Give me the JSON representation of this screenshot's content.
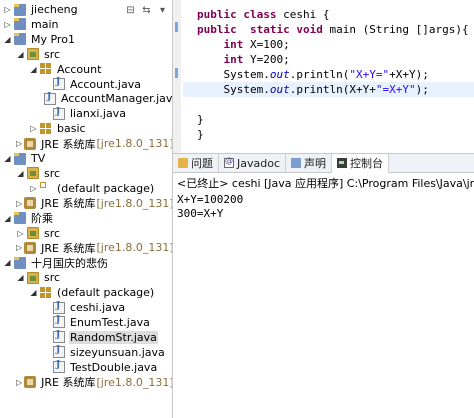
{
  "explorer": {
    "toolbar": {
      "collapse_icon": "collapse-all-icon",
      "link_icon": "link-editor-icon",
      "menu_icon": "view-menu-icon"
    },
    "tree": [
      {
        "label": "jiecheng",
        "icon": "project-icon",
        "depth": 0,
        "expanded": false
      },
      {
        "label": "main",
        "icon": "project-icon",
        "depth": 0,
        "expanded": false
      },
      {
        "label": "My Pro1",
        "icon": "project-icon",
        "depth": 0,
        "expanded": true
      },
      {
        "label": "src",
        "icon": "source-folder-icon",
        "depth": 1,
        "expanded": true
      },
      {
        "label": "Account",
        "icon": "package-icon",
        "depth": 2,
        "expanded": true
      },
      {
        "label": "Account.java",
        "icon": "java-file-icon",
        "depth": 3,
        "expanded": false
      },
      {
        "label": "AccountManager.java",
        "icon": "java-file-icon",
        "depth": 3,
        "expanded": false
      },
      {
        "label": "lianxi.java",
        "icon": "java-file-icon",
        "depth": 3,
        "expanded": false
      },
      {
        "label": "basic",
        "icon": "package-icon",
        "depth": 2,
        "expanded": false
      },
      {
        "label": "JRE 系统库",
        "sub": "[jre1.8.0_131]",
        "icon": "library-icon",
        "depth": 1,
        "expanded": false
      },
      {
        "label": "TV",
        "icon": "project-icon",
        "depth": 0,
        "expanded": true
      },
      {
        "label": "src",
        "icon": "source-folder-icon",
        "depth": 1,
        "expanded": true
      },
      {
        "label": "(default package)",
        "icon": "package-empty-icon",
        "depth": 2,
        "expanded": false
      },
      {
        "label": "JRE 系统库",
        "sub": "[jre1.8.0_131]",
        "icon": "library-icon",
        "depth": 1,
        "expanded": false
      },
      {
        "label": "阶乘",
        "icon": "project-icon",
        "depth": 0,
        "expanded": true
      },
      {
        "label": "src",
        "icon": "source-folder-icon",
        "depth": 1,
        "expanded": false
      },
      {
        "label": "JRE 系统库",
        "sub": "[jre1.8.0_131]",
        "icon": "library-icon",
        "depth": 1,
        "expanded": false
      },
      {
        "label": "十月国庆的悲伤",
        "icon": "project-icon",
        "depth": 0,
        "expanded": true
      },
      {
        "label": "src",
        "icon": "source-folder-icon",
        "depth": 1,
        "expanded": true
      },
      {
        "label": "(default package)",
        "icon": "package-icon",
        "depth": 2,
        "expanded": true
      },
      {
        "label": "ceshi.java",
        "icon": "java-file-icon",
        "depth": 3,
        "expanded": false
      },
      {
        "label": "EnumTest.java",
        "icon": "java-file-icon",
        "depth": 3,
        "expanded": false
      },
      {
        "label": "RandomStr.java",
        "icon": "java-file-icon",
        "depth": 3,
        "expanded": false,
        "selected": true
      },
      {
        "label": "sizeyunsuan.java",
        "icon": "java-file-icon",
        "depth": 3,
        "expanded": false
      },
      {
        "label": "TestDouble.java",
        "icon": "java-file-icon",
        "depth": 3,
        "expanded": false
      },
      {
        "label": "JRE 系统库",
        "sub": "[jre1.8.0_131]",
        "icon": "library-icon",
        "depth": 1,
        "expanded": false
      }
    ]
  },
  "editor": {
    "lines": [
      "public class ceshi {",
      "public  static void main (String []args){",
      "    int X=100;",
      "    int Y=200;",
      "    System.out.println(\"X+Y=\"+X+Y);",
      "    System.out.println(X+Y+\"=X+Y\");",
      "",
      "}",
      "}"
    ],
    "current_line": 5
  },
  "console": {
    "tabs": [
      {
        "label": "问题",
        "icon": "problems-icon",
        "active": false
      },
      {
        "label": "Javadoc",
        "icon": "javadoc-icon",
        "active": false
      },
      {
        "label": "声明",
        "icon": "declaration-icon",
        "active": false
      },
      {
        "label": "控制台",
        "icon": "console-icon",
        "active": true
      }
    ],
    "header": "<已终止> ceshi [Java 应用程序] C:\\Program Files\\Java\\jre1.8.0_13",
    "output": [
      "X+Y=100200",
      "300=X+Y"
    ]
  }
}
